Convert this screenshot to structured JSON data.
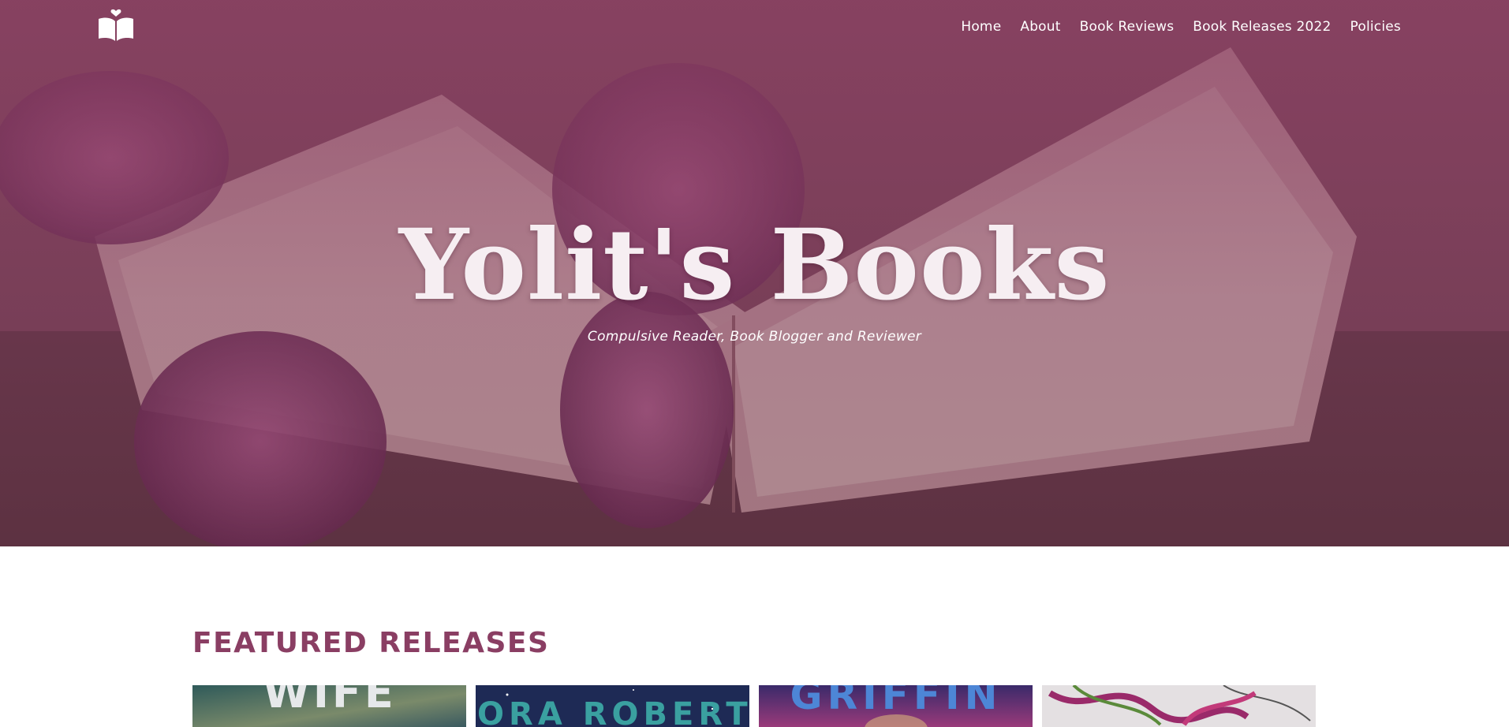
{
  "site": {
    "logo_icon": "open-book-heart-icon",
    "nav": [
      {
        "label": "Home"
      },
      {
        "label": "About"
      },
      {
        "label": "Book Reviews"
      },
      {
        "label": "Book Releases 2022"
      },
      {
        "label": "Policies"
      }
    ]
  },
  "hero": {
    "title": "Yolit's Books",
    "tagline": "Compulsive Reader, Book Blogger and Reviewer"
  },
  "featured": {
    "heading": "FEATURED RELEASES",
    "covers": [
      {
        "text": "WIFE"
      },
      {
        "text": "NORA ROBERTS"
      },
      {
        "text": "GRIFFIN"
      },
      {
        "text": ""
      }
    ]
  },
  "colors": {
    "brand": "#8a3e63",
    "hero_overlay": "#8c4064",
    "text_on_hero": "#ffffff"
  }
}
